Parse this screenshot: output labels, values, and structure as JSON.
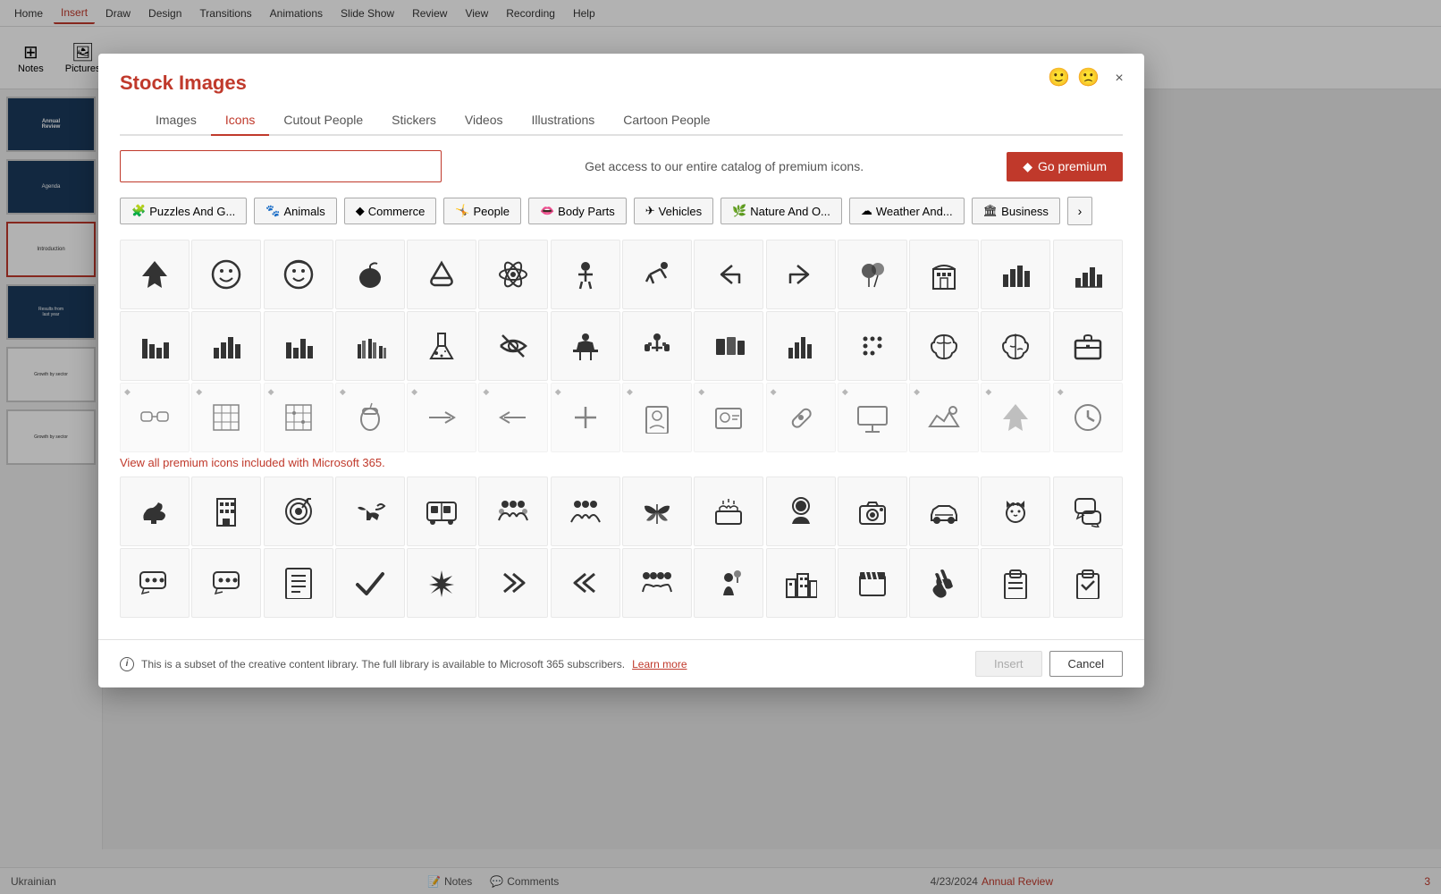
{
  "app": {
    "menu_items": [
      "Home",
      "Insert",
      "Draw",
      "Design",
      "Transitions",
      "Animations",
      "Slide Show",
      "Review",
      "View",
      "Recording",
      "Help"
    ],
    "active_menu": "Insert"
  },
  "dialog": {
    "title": "Stock Images",
    "close_label": "×",
    "tabs": [
      {
        "id": "images",
        "label": "Images"
      },
      {
        "id": "icons",
        "label": "Icons",
        "active": true
      },
      {
        "id": "cutout",
        "label": "Cutout People"
      },
      {
        "id": "stickers",
        "label": "Stickers"
      },
      {
        "id": "videos",
        "label": "Videos"
      },
      {
        "id": "illustrations",
        "label": "Illustrations"
      },
      {
        "id": "cartoon",
        "label": "Cartoon People"
      }
    ],
    "search": {
      "placeholder": "",
      "hint": "Get access to our entire catalog of premium icons."
    },
    "premium_button": "Go premium",
    "categories": [
      {
        "label": "Puzzles And G...",
        "icon": "🧩"
      },
      {
        "label": "Animals",
        "icon": "🐾"
      },
      {
        "label": "Commerce",
        "icon": "💎"
      },
      {
        "label": "People",
        "icon": "🤸"
      },
      {
        "label": "Body Parts",
        "icon": "👄"
      },
      {
        "label": "Vehicles",
        "icon": "✈️"
      },
      {
        "label": "Nature And O...",
        "icon": "🌿"
      },
      {
        "label": "Weather And...",
        "icon": "☁️"
      },
      {
        "label": "Business",
        "icon": "🏛️"
      }
    ],
    "icons_row1": [
      "✈",
      "😊",
      "😇",
      "🍎",
      "↺",
      "⚛",
      "🧒",
      "🤸",
      "↩",
      "↪",
      "🎈",
      "🏛",
      "📊",
      "📊"
    ],
    "icons_row2": [
      "📊",
      "📊",
      "📊",
      "📊",
      "🧪",
      "👁️",
      "👔",
      "🏋",
      "📚",
      "📊",
      "⠿",
      "🧠",
      "🧠",
      "💼"
    ],
    "icons_row3_premium": [
      "🥽",
      "🔢",
      "🔢",
      "🌰",
      "→",
      "←",
      "✚",
      "👤",
      "🪪",
      "🩹",
      "📺",
      "🌱",
      "✈",
      "⏰"
    ],
    "premium_link": "View all premium icons included with Microsoft 365.",
    "icons_row4": [
      "🦕",
      "🏢",
      "🎯",
      "🐦",
      "🚌",
      "👥",
      "👥",
      "🦋",
      "🎂",
      "👤",
      "📷",
      "🚗",
      "🐈",
      "💬"
    ],
    "icons_row5": [
      "💬",
      "💬",
      "📋",
      "✔",
      "🌟",
      "»",
      "«",
      "👥",
      "🎈",
      "🏙",
      "🎬",
      "👏",
      "📋",
      "📋"
    ],
    "footer": {
      "info_text": "This is a subset of the creative content library. The full library is available to Microsoft 365 subscribers.",
      "learn_more": "Learn more"
    },
    "buttons": {
      "insert": "Insert",
      "cancel": "Cancel"
    }
  },
  "status_bar": {
    "slide_info": "Ukrainian",
    "notes": "Notes",
    "comments": "Comments",
    "slide_number": "3",
    "date": "4/23/2024",
    "presentation": "Annual Review"
  },
  "slide_thumbnails": [
    {
      "label": "Annual\nReview",
      "active": false
    },
    {
      "label": "Agenda",
      "active": false
    },
    {
      "label": "Introduction",
      "active": true
    },
    {
      "label": "Results from\nlast year",
      "active": false
    },
    {
      "label": "Growth by\nsector",
      "active": false
    },
    {
      "label": "Growth by\nsector",
      "active": false
    }
  ],
  "icons": {
    "unicode": {
      "airplane": "✈",
      "smile": "🙂",
      "angel": "😇",
      "apple": "🍎",
      "recycle": "♻",
      "atom": "⚛",
      "baby": "👶",
      "gymnastics": "🤸",
      "reply": "↩",
      "forward": "↪",
      "balloon": "🎈",
      "building": "🏛",
      "chart1": "📊",
      "chart2": "📈",
      "bars1": "▐",
      "bars2": "▌",
      "bars3": "▬",
      "bars4": "▐",
      "flask": "🧪",
      "eye": "👁",
      "person_desk": "🧑‍💻",
      "weightlift": "🏋",
      "books": "📚",
      "chart3": "📊",
      "braille": "⠿",
      "brain1": "🧠",
      "brain2": "🧠",
      "briefcase": "💼",
      "glasses3d": "🥽",
      "grid1": "⊞",
      "grid2": "⊟",
      "acorn": "🌰",
      "arrow_r": "→",
      "arrow_l": "←",
      "plus": "+",
      "person_card": "🪪",
      "id_card": "🪪",
      "bandage": "🩹",
      "billboard": "📺",
      "landscape": "🌄",
      "plane2": "✈",
      "clock": "⏰",
      "dinosaur": "🦕",
      "office": "🏢",
      "target": "🎯",
      "bird": "🐦",
      "bus": "🚌",
      "crowd1": "👥",
      "crowd2": "👥",
      "butterfly": "🦋",
      "cake": "🎂",
      "person_hd": "👤",
      "camera": "📷",
      "car": "🚗",
      "cat": "🐈",
      "chat1": "💬",
      "chat2": "💬",
      "chat3": "💬",
      "checklist": "📋",
      "checkmark": "✔",
      "sparkle": "✦",
      "dbl_right": "»",
      "dbl_left": "«",
      "team": "👥",
      "balloon2": "🎈",
      "cityscape": "🏙",
      "clapboard": "🎬",
      "clap": "👏",
      "clipboard1": "📋",
      "clipboard2": "📋",
      "diamond": "◆"
    }
  }
}
